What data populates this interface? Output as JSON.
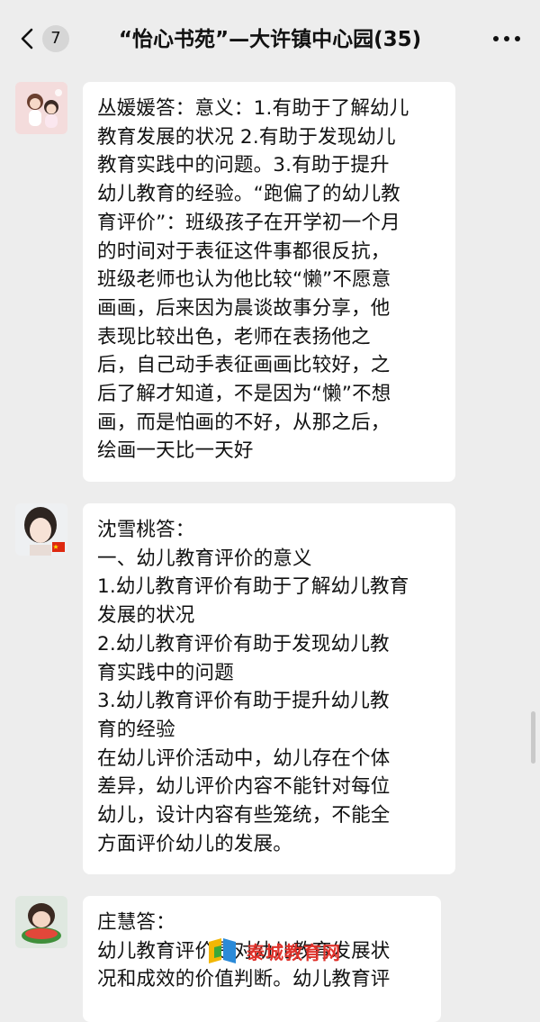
{
  "header": {
    "unread_count": "7",
    "title": "“怡心书苑”—大许镇中心园(35)"
  },
  "messages": [
    {
      "text": "丛媛媛答：意义：1.有助于了解幼儿\n教育发展的状况 2.有助于发现幼儿\n教育实践中的问题。3.有助于提升\n幼儿教育的经验。“跑偏了的幼儿教\n育评价”：班级孩子在开学初一个月\n的时间对于表征这件事都很反抗，\n班级老师也认为他比较“懒”不愿意\n画画，后来因为晨谈故事分享，他\n表现比较出色，老师在表扬他之\n后，自己动手表征画画比较好，之\n后了解才知道，不是因为“懒”不想\n画，而是怕画的不好，从那之后，\n绘画一天比一天好"
    },
    {
      "text": "沈雪桃答：\n一、幼儿教育评价的意义\n1.幼儿教育评价有助于了解幼儿教育\n发展的状况\n2.幼儿教育评价有助于发现幼儿教\n育实践中的问题\n3.幼儿教育评价有助于提升幼儿教\n育的经验\n在幼儿评价活动中，幼儿存在个体\n差异，幼儿评价内容不能针对每位\n幼儿，设计内容有些笼统，不能全\n方面评价幼儿的发展。"
    },
    {
      "text": "庄慧答：\n幼儿教育评价是对幼儿教育发展状\n况和成效的价值判断。幼儿教育评"
    }
  ],
  "watermark": {
    "text": "泰城教育网"
  },
  "colors": {
    "background": "#ededed",
    "bubble": "#ffffff",
    "watermark": "#e0322b"
  },
  "icons": {
    "back": "chevron-left-icon",
    "more": "more-dots-icon"
  }
}
